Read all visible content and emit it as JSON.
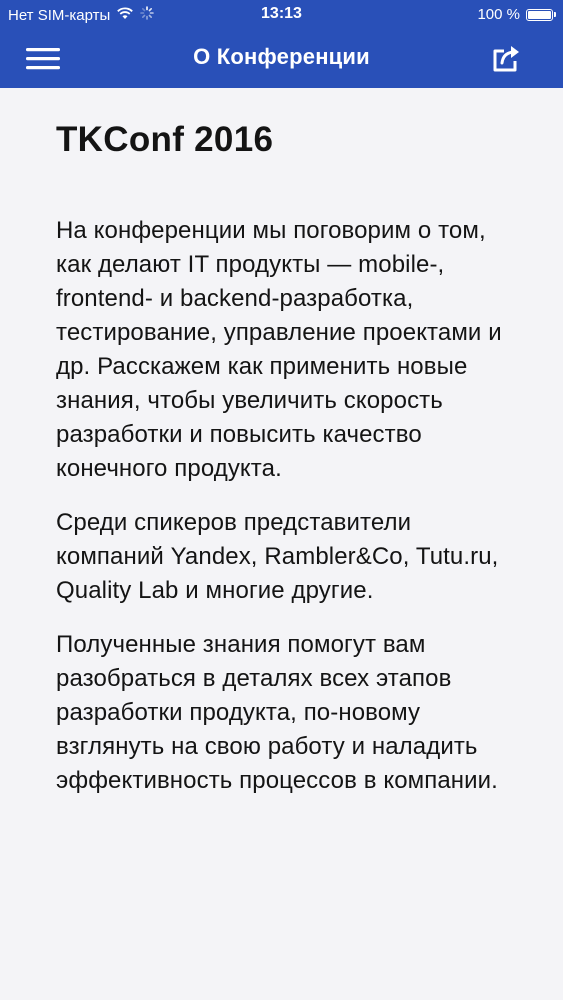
{
  "status_bar": {
    "carrier": "Нет SIM-карты",
    "time": "13:13",
    "battery_text": "100 %",
    "battery_level": 1.0,
    "icons": [
      "wifi-icon",
      "activity-spinner-icon",
      "battery-icon"
    ]
  },
  "nav": {
    "title": "О Конференции",
    "menu_icon": "hamburger-menu-icon",
    "share_icon": "share-icon"
  },
  "content": {
    "title": "TKConf 2016",
    "paragraphs": [
      "На конференции мы поговорим о том, как делают IT продукты — mobile-, frontend- и backend-разработка, тестирование, управление проектами и др. Расскажем как применить новые знания, чтобы увеличить скорость разработки и повысить качество конечного продукта.",
      "Среди спикеров представители компаний Yandex, Rambler&Co, Tutu.ru, Quality Lab и многие другие.",
      "Полученные знания помогут вам разобраться в деталях всех этапов разработки продукта, по-новому взглянуть на свою работу и наладить эффективность процессов в компании."
    ]
  },
  "colors": {
    "header_bg": "#2950b8",
    "page_bg": "#f4f4f7",
    "text": "#141414"
  }
}
